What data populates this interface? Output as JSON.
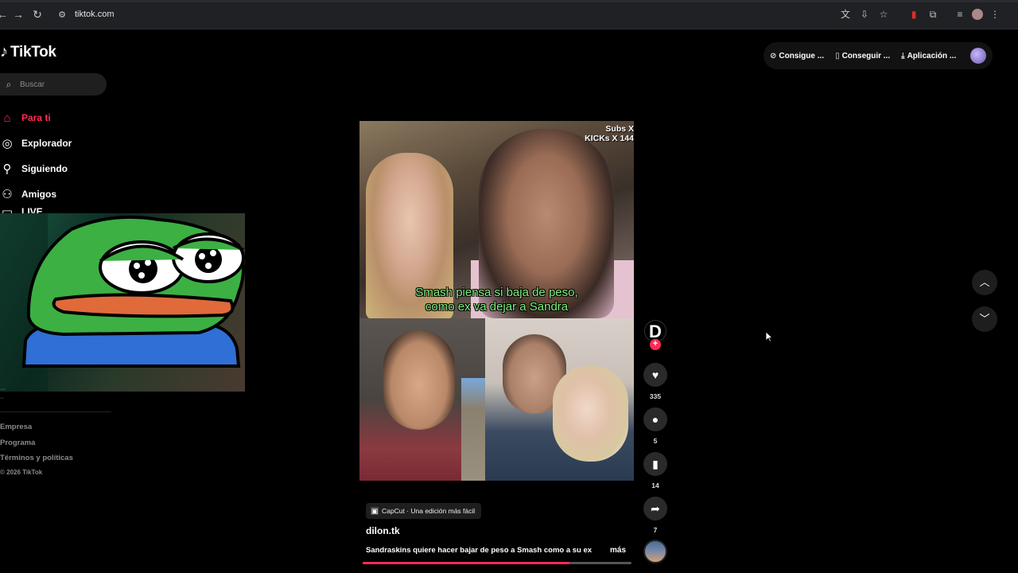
{
  "browser": {
    "url": "tiktok.com",
    "icons": {
      "back": "back-arrow-icon",
      "forward": "forward-arrow-icon",
      "reload": "reload-icon",
      "site_info": "tune-icon"
    }
  },
  "brand": {
    "logo_text": "TikTok",
    "accent": "#fe2c55"
  },
  "search": {
    "placeholder": "Buscar"
  },
  "sidebar": {
    "items": [
      {
        "label": "Para ti",
        "icon": "home-icon",
        "active": true
      },
      {
        "label": "Explorador",
        "icon": "compass-icon",
        "active": false
      },
      {
        "label": "Siguiendo",
        "icon": "person-follow-icon",
        "active": false
      },
      {
        "label": "Amigos",
        "icon": "friends-icon",
        "active": false
      },
      {
        "label": "LIVE",
        "icon": "live-icon",
        "active": false
      }
    ],
    "footer_links": [
      "Empresa",
      "Programa",
      "Términos y políticas"
    ],
    "copyright": "© 2026 TikTok"
  },
  "header_actions": {
    "coins": "Consigue ...",
    "get_app": "Conseguir ...",
    "app": "Aplicación ..."
  },
  "video": {
    "overlay_top_right": [
      "Subs X",
      "KICKs X 144"
    ],
    "caption_lines": [
      "Smash piensa si baja de peso,",
      "como ex va dejar a Sandra"
    ],
    "capcut_label": "CapCut · Una edición más fácil",
    "username": "dilon.tk",
    "description": "Sandraskins quiere hacer bajar de peso a Smash como a su ex",
    "more_label": "más",
    "progress": 0.77
  },
  "rail": {
    "avatar_letter": "D",
    "likes": "335",
    "comments": "5",
    "saves": "14",
    "shares": "7"
  }
}
